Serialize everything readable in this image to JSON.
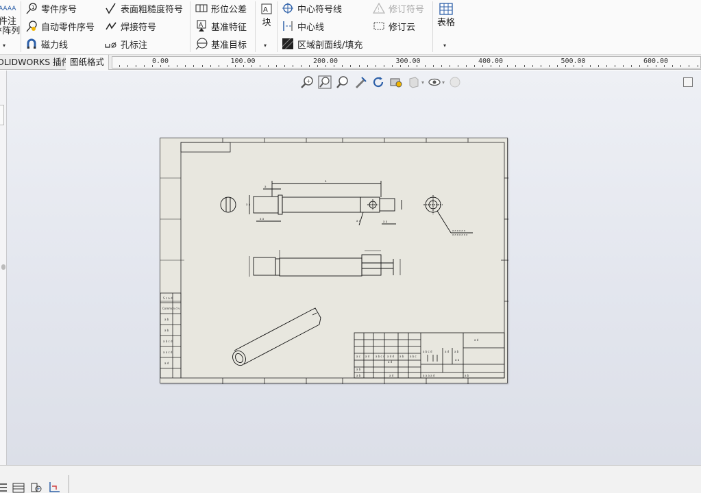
{
  "ribbon": {
    "note_part_top": "注",
    "note_part_bottom": "阵列",
    "col1": {
      "balloon": "零件序号",
      "auto_balloon": "自动零件序号",
      "magnetic_line": "磁力线"
    },
    "col2": {
      "surface_finish": "表面粗糙度符号",
      "weld_symbol": "焊接符号",
      "hole_callout": "孔标注"
    },
    "col3": {
      "geometric_tolerance": "形位公差",
      "datum_feature": "基准特征",
      "datum_target": "基准目标"
    },
    "block_label": "块",
    "col4": {
      "center_mark": "中心符号线",
      "centerline": "中心线",
      "area_hatch": "区域剖面线/填充"
    },
    "col5": {
      "revision_symbol": "修订符号",
      "revision_cloud": "修订云"
    },
    "table_label": "表格"
  },
  "tabs": {
    "addins": "OLIDWORKS 插件",
    "sheet_format": "图纸格式"
  },
  "ruler": {
    "labels": [
      "0.00",
      "100.00",
      "200.00",
      "300.00",
      "400.00",
      "500.00",
      "600.00"
    ]
  },
  "colors": {
    "ribbon_bg": "#fafafa",
    "sheet_bg": "#e8e7df",
    "accent_blue": "#2c5fa8",
    "disabled_text": "#a9a9a9"
  },
  "icons": {
    "balloon": "balloon-icon",
    "zoom": "zoom-to-fit-icon",
    "rotate": "rotate-icon",
    "view": "view-orientation-icon"
  }
}
